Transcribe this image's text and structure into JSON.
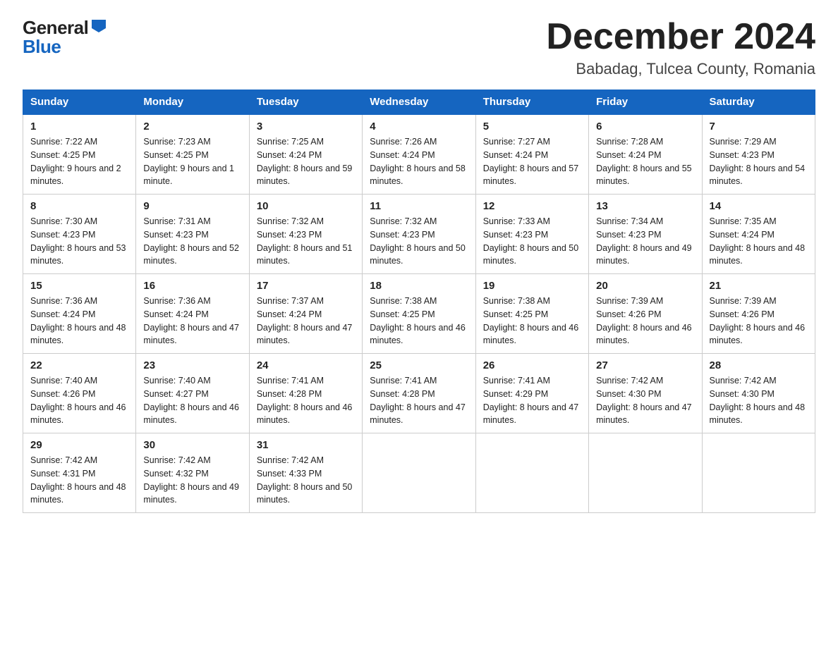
{
  "header": {
    "title": "December 2024",
    "subtitle": "Babadag, Tulcea County, Romania",
    "logo_general": "General",
    "logo_blue": "Blue"
  },
  "days_of_week": [
    "Sunday",
    "Monday",
    "Tuesday",
    "Wednesday",
    "Thursday",
    "Friday",
    "Saturday"
  ],
  "weeks": [
    [
      {
        "num": "1",
        "sunrise": "7:22 AM",
        "sunset": "4:25 PM",
        "daylight": "9 hours and 2 minutes."
      },
      {
        "num": "2",
        "sunrise": "7:23 AM",
        "sunset": "4:25 PM",
        "daylight": "9 hours and 1 minute."
      },
      {
        "num": "3",
        "sunrise": "7:25 AM",
        "sunset": "4:24 PM",
        "daylight": "8 hours and 59 minutes."
      },
      {
        "num": "4",
        "sunrise": "7:26 AM",
        "sunset": "4:24 PM",
        "daylight": "8 hours and 58 minutes."
      },
      {
        "num": "5",
        "sunrise": "7:27 AM",
        "sunset": "4:24 PM",
        "daylight": "8 hours and 57 minutes."
      },
      {
        "num": "6",
        "sunrise": "7:28 AM",
        "sunset": "4:24 PM",
        "daylight": "8 hours and 55 minutes."
      },
      {
        "num": "7",
        "sunrise": "7:29 AM",
        "sunset": "4:23 PM",
        "daylight": "8 hours and 54 minutes."
      }
    ],
    [
      {
        "num": "8",
        "sunrise": "7:30 AM",
        "sunset": "4:23 PM",
        "daylight": "8 hours and 53 minutes."
      },
      {
        "num": "9",
        "sunrise": "7:31 AM",
        "sunset": "4:23 PM",
        "daylight": "8 hours and 52 minutes."
      },
      {
        "num": "10",
        "sunrise": "7:32 AM",
        "sunset": "4:23 PM",
        "daylight": "8 hours and 51 minutes."
      },
      {
        "num": "11",
        "sunrise": "7:32 AM",
        "sunset": "4:23 PM",
        "daylight": "8 hours and 50 minutes."
      },
      {
        "num": "12",
        "sunrise": "7:33 AM",
        "sunset": "4:23 PM",
        "daylight": "8 hours and 50 minutes."
      },
      {
        "num": "13",
        "sunrise": "7:34 AM",
        "sunset": "4:23 PM",
        "daylight": "8 hours and 49 minutes."
      },
      {
        "num": "14",
        "sunrise": "7:35 AM",
        "sunset": "4:24 PM",
        "daylight": "8 hours and 48 minutes."
      }
    ],
    [
      {
        "num": "15",
        "sunrise": "7:36 AM",
        "sunset": "4:24 PM",
        "daylight": "8 hours and 48 minutes."
      },
      {
        "num": "16",
        "sunrise": "7:36 AM",
        "sunset": "4:24 PM",
        "daylight": "8 hours and 47 minutes."
      },
      {
        "num": "17",
        "sunrise": "7:37 AM",
        "sunset": "4:24 PM",
        "daylight": "8 hours and 47 minutes."
      },
      {
        "num": "18",
        "sunrise": "7:38 AM",
        "sunset": "4:25 PM",
        "daylight": "8 hours and 46 minutes."
      },
      {
        "num": "19",
        "sunrise": "7:38 AM",
        "sunset": "4:25 PM",
        "daylight": "8 hours and 46 minutes."
      },
      {
        "num": "20",
        "sunrise": "7:39 AM",
        "sunset": "4:26 PM",
        "daylight": "8 hours and 46 minutes."
      },
      {
        "num": "21",
        "sunrise": "7:39 AM",
        "sunset": "4:26 PM",
        "daylight": "8 hours and 46 minutes."
      }
    ],
    [
      {
        "num": "22",
        "sunrise": "7:40 AM",
        "sunset": "4:26 PM",
        "daylight": "8 hours and 46 minutes."
      },
      {
        "num": "23",
        "sunrise": "7:40 AM",
        "sunset": "4:27 PM",
        "daylight": "8 hours and 46 minutes."
      },
      {
        "num": "24",
        "sunrise": "7:41 AM",
        "sunset": "4:28 PM",
        "daylight": "8 hours and 46 minutes."
      },
      {
        "num": "25",
        "sunrise": "7:41 AM",
        "sunset": "4:28 PM",
        "daylight": "8 hours and 47 minutes."
      },
      {
        "num": "26",
        "sunrise": "7:41 AM",
        "sunset": "4:29 PM",
        "daylight": "8 hours and 47 minutes."
      },
      {
        "num": "27",
        "sunrise": "7:42 AM",
        "sunset": "4:30 PM",
        "daylight": "8 hours and 47 minutes."
      },
      {
        "num": "28",
        "sunrise": "7:42 AM",
        "sunset": "4:30 PM",
        "daylight": "8 hours and 48 minutes."
      }
    ],
    [
      {
        "num": "29",
        "sunrise": "7:42 AM",
        "sunset": "4:31 PM",
        "daylight": "8 hours and 48 minutes."
      },
      {
        "num": "30",
        "sunrise": "7:42 AM",
        "sunset": "4:32 PM",
        "daylight": "8 hours and 49 minutes."
      },
      {
        "num": "31",
        "sunrise": "7:42 AM",
        "sunset": "4:33 PM",
        "daylight": "8 hours and 50 minutes."
      },
      null,
      null,
      null,
      null
    ]
  ],
  "labels": {
    "sunrise": "Sunrise:",
    "sunset": "Sunset:",
    "daylight": "Daylight:"
  }
}
